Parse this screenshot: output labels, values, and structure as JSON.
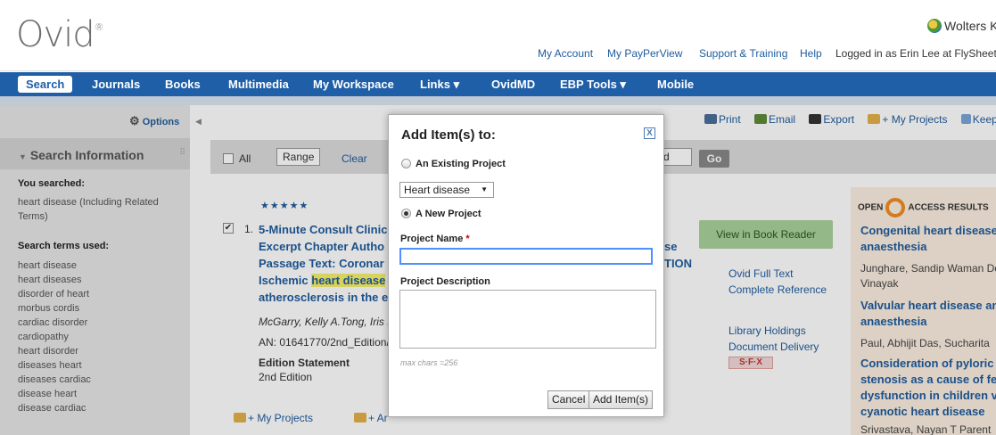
{
  "header": {
    "logo": "Ovid",
    "logo_mark": "®",
    "brand": "Wolters K",
    "links": [
      "My Account",
      "My PayPerView",
      "Support & Training",
      "Help"
    ],
    "logged_in": "Logged in as Erin Lee at FlySheet"
  },
  "nav": {
    "items": [
      "Search",
      "Journals",
      "Books",
      "Multimedia",
      "My Workspace",
      "Links ▾",
      "OvidMD",
      "EBP Tools ▾",
      "Mobile"
    ]
  },
  "sidebar": {
    "options": "Options",
    "title": "Search Information",
    "you_searched_label": "You searched:",
    "you_searched_1": "heart disease (Including Related",
    "you_searched_2": "Terms)",
    "terms_label": "Search terms used:",
    "terms": [
      "heart disease",
      "heart diseases",
      "disorder of heart",
      "morbus cordis",
      "cardiac disorder",
      "cardiopathy",
      "heart disorder",
      "diseases heart",
      "diseases cardiac",
      "disease heart",
      "disease cardiac"
    ]
  },
  "toolbar": {
    "print": "Print",
    "email": "Email",
    "export": "Export",
    "projects": "+ My Projects",
    "keep": "Keep S"
  },
  "results_bar": {
    "all": "All",
    "range": "Range",
    "clear": "Clear",
    "go": "Go",
    "field_frag": "d"
  },
  "result": {
    "stars": "★★★★★",
    "number": "1.",
    "title_1": "5-Minute Consult Clinic",
    "title_2": "Excerpt Chapter Autho",
    "title_3": "Passage Text: Coronar",
    "title_4a": "Ischemic ",
    "title_4b": "heart disease",
    "title_5": "atherosclerosis in the e",
    "frag_1": "se",
    "frag_2": "TION",
    "authors": "McGarry, Kelly A.Tong, Iris L",
    "an": "AN: 01641770/2nd_Edition/",
    "edition_label": "Edition Statement",
    "edition": "2nd Edition",
    "my_projects": "+ My Projects",
    "annotate": "+ Ar"
  },
  "result_links": {
    "view_book": "View in Book Reader",
    "full_text": "Ovid Full Text",
    "complete_ref": "Complete Reference",
    "holdings": "Library Holdings",
    "delivery": "Document Delivery",
    "sfx": "S·F·X"
  },
  "open_access": {
    "head_left": "OPEN",
    "head_right": "ACCESS RESULTS",
    "items": [
      {
        "t1": "Congenital heart disease",
        "t2": "anaesthesia",
        "a1": "Junghare, Sandip Waman De",
        "a2": "Vinayak"
      },
      {
        "t1": "Valvular heart disease an",
        "t2": "anaesthesia",
        "a1": "Paul, Abhijit Das, Sucharita",
        "a2": ""
      },
      {
        "t1": "Consideration of pyloric",
        "t2": "stenosis as a cause of fe",
        "t3": "dysfunction in children v",
        "t4": "cyanotic heart disease",
        "a1": "Srivastava, Nayan T Parent"
      }
    ]
  },
  "dialog": {
    "title": "Add Item(s) to:",
    "close": "X",
    "existing": "An Existing Project",
    "select_value": "Heart disease",
    "new": "A New Project",
    "name_label": "Project Name",
    "required": "*",
    "name_value": "",
    "desc_label": "Project Description",
    "desc_value": "",
    "max_chars": "max chars =256",
    "cancel": "Cancel",
    "add": "Add Item(s)"
  },
  "colors": {
    "nav": "#1f5fa8",
    "link": "#1f5c9e",
    "view_book": "#a9d29a",
    "oa_panel": "#fbeee0",
    "highlight": "#f6ef6c"
  }
}
